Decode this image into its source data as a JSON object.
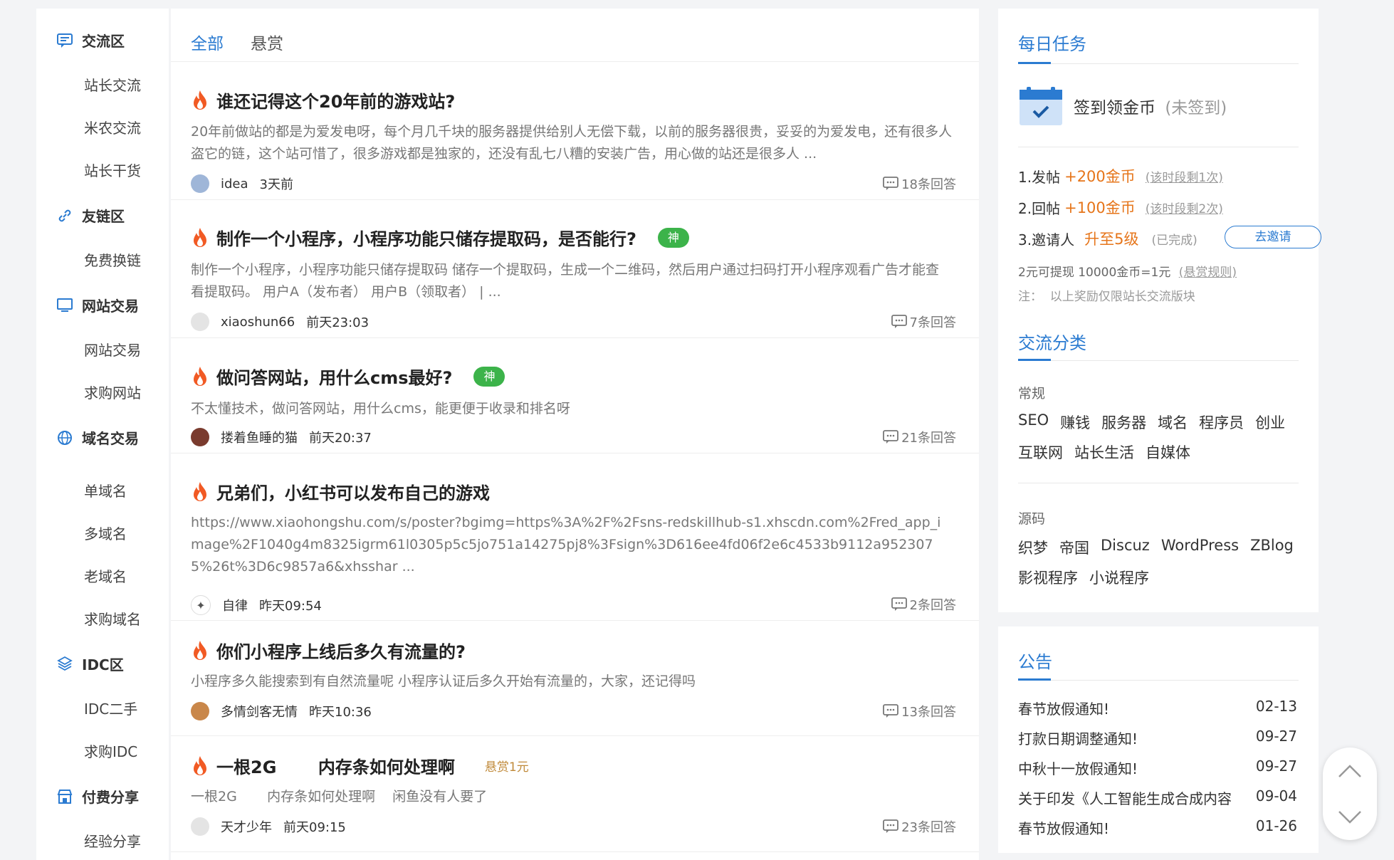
{
  "nav": {
    "groups": [
      {
        "label": "交流区",
        "icon": "chat-icon",
        "subs": [
          "站长交流",
          "米农交流",
          "站长干货"
        ]
      },
      {
        "label": "友链区",
        "icon": "link-icon",
        "subs": [
          "免费换链"
        ]
      },
      {
        "label": "网站交易",
        "icon": "monitor-icon",
        "subs": [
          "网站交易",
          "求购网站"
        ]
      },
      {
        "label": "域名交易",
        "icon": "globe-icon",
        "subs": [
          "单域名",
          "多域名",
          "老域名",
          "求购域名"
        ]
      },
      {
        "label": "IDC区",
        "icon": "cube-icon",
        "subs": [
          "IDC二手",
          "求购IDC"
        ]
      },
      {
        "label": "付费分享",
        "icon": "store-icon",
        "subs": [
          "经验分享"
        ]
      }
    ]
  },
  "tabs": [
    "全部",
    "悬赏"
  ],
  "posts": [
    {
      "title": "谁还记得这个20年前的游戏站?",
      "badge": "",
      "bounty": "",
      "excerpt": "20年前做站的都是为爱发电呀，每个月几千块的服务器提供给别人无偿下载，以前的服务器很贵，妥妥的为爱发电，还有很多人盗它的链，这个站可惜了，很多游戏都是独家的，还没有乱七八糟的安装广告，用心做的站还是很多人 ...",
      "author": "idea",
      "time": "3天前",
      "replies": "18条回答"
    },
    {
      "title": "制作一个小程序，小程序功能只储存提取码，是否能行?",
      "badge": "神",
      "bounty": "",
      "excerpt": "制作一个小程序，小程序功能只储存提取码 储存一个提取码，生成一个二维码，然后用户通过扫码打开小程序观看广告才能查看提取码。 用户A（发布者） 用户B（领取者） | ...",
      "author": "xiaoshun66",
      "time": "前天23:03",
      "replies": "7条回答"
    },
    {
      "title": "做问答网站，用什么cms最好?",
      "badge": "神",
      "bounty": "",
      "excerpt": "不太懂技术，做问答网站，用什么cms，能更便于收录和排名呀",
      "author": "搂着鱼睡的猫",
      "time": "前天20:37",
      "replies": "21条回答"
    },
    {
      "title": "兄弟们，小红书可以发布自己的游戏",
      "badge": "",
      "bounty": "",
      "excerpt": "https://www.xiaohongshu.com/s/poster?bgimg=https%3A%2F%2Fsns-redskillhub-s1.xhscdn.com%2Fred_app_image%2F1040g4m8325igrm61l0305p5c5jo751a14275pj8%3Fsign%3D616ee4fd06f2e6c4533b9112a9523075%26t%3D6c9857a6&xhsshar ...",
      "author": "自律",
      "time": "昨天09:54",
      "replies": "2条回答"
    },
    {
      "title": "你们小程序上线后多久有流量的?",
      "badge": "",
      "bounty": "",
      "excerpt": "小程序多久能搜索到有自然流量呢 小程序认证后多久开始有流量的，大家，还记得吗",
      "author": "多情剑客无情",
      "time": "昨天10:36",
      "replies": "13条回答"
    },
    {
      "title": "一根2G       内存条如何处理啊",
      "badge": "",
      "bounty": "悬赏1元",
      "excerpt": "一根2G       内存条如何处理啊    闲鱼没有人要了",
      "author": "天才少年",
      "time": "前天09:15",
      "replies": "23条回答"
    }
  ],
  "daily": {
    "title": "每日任务",
    "checkin_label": "签到领金币",
    "checkin_status": "(未签到)",
    "tasks": [
      {
        "name": "1.发帖",
        "reward": "+200金币",
        "note": "(该时段剩1次)"
      },
      {
        "name": "2.回帖",
        "reward": "+100金币",
        "note": "(该时段剩2次)"
      },
      {
        "name": "3.邀请人",
        "reward": "升至5级",
        "note": "(已完成)"
      }
    ],
    "invite_button": "去邀请",
    "withdraw": "2元可提现 10000金币=1元",
    "rule_link": "(悬赏规则)",
    "footnote": "注：  以上奖励仅限站长交流版块"
  },
  "categories": {
    "title": "交流分类",
    "groups": [
      {
        "head": "常规",
        "rows": [
          [
            "SEO",
            "赚钱",
            "服务器",
            "域名",
            "程序员",
            "创业"
          ],
          [
            "互联网",
            "站长生活",
            "自媒体"
          ]
        ]
      },
      {
        "head": "源码",
        "rows": [
          [
            "织梦",
            "帝国",
            "Discuz",
            "WordPress",
            "ZBlog"
          ],
          [
            "影视程序",
            "小说程序"
          ]
        ]
      }
    ]
  },
  "notice": {
    "title": "公告",
    "items": [
      {
        "title": "春节放假通知!",
        "date": "02-13"
      },
      {
        "title": "打款日期调整通知!",
        "date": "09-27"
      },
      {
        "title": "中秋十一放假通知!",
        "date": "09-27"
      },
      {
        "title": "关于印发《人工智能生成合成内容",
        "date": "09-04"
      },
      {
        "title": "春节放假通知!",
        "date": "01-26"
      }
    ]
  },
  "colors": {
    "accent": "#2b7bd1",
    "gold": "#e6751a",
    "badge": "#3cb34a",
    "fire": "#f15a24"
  }
}
